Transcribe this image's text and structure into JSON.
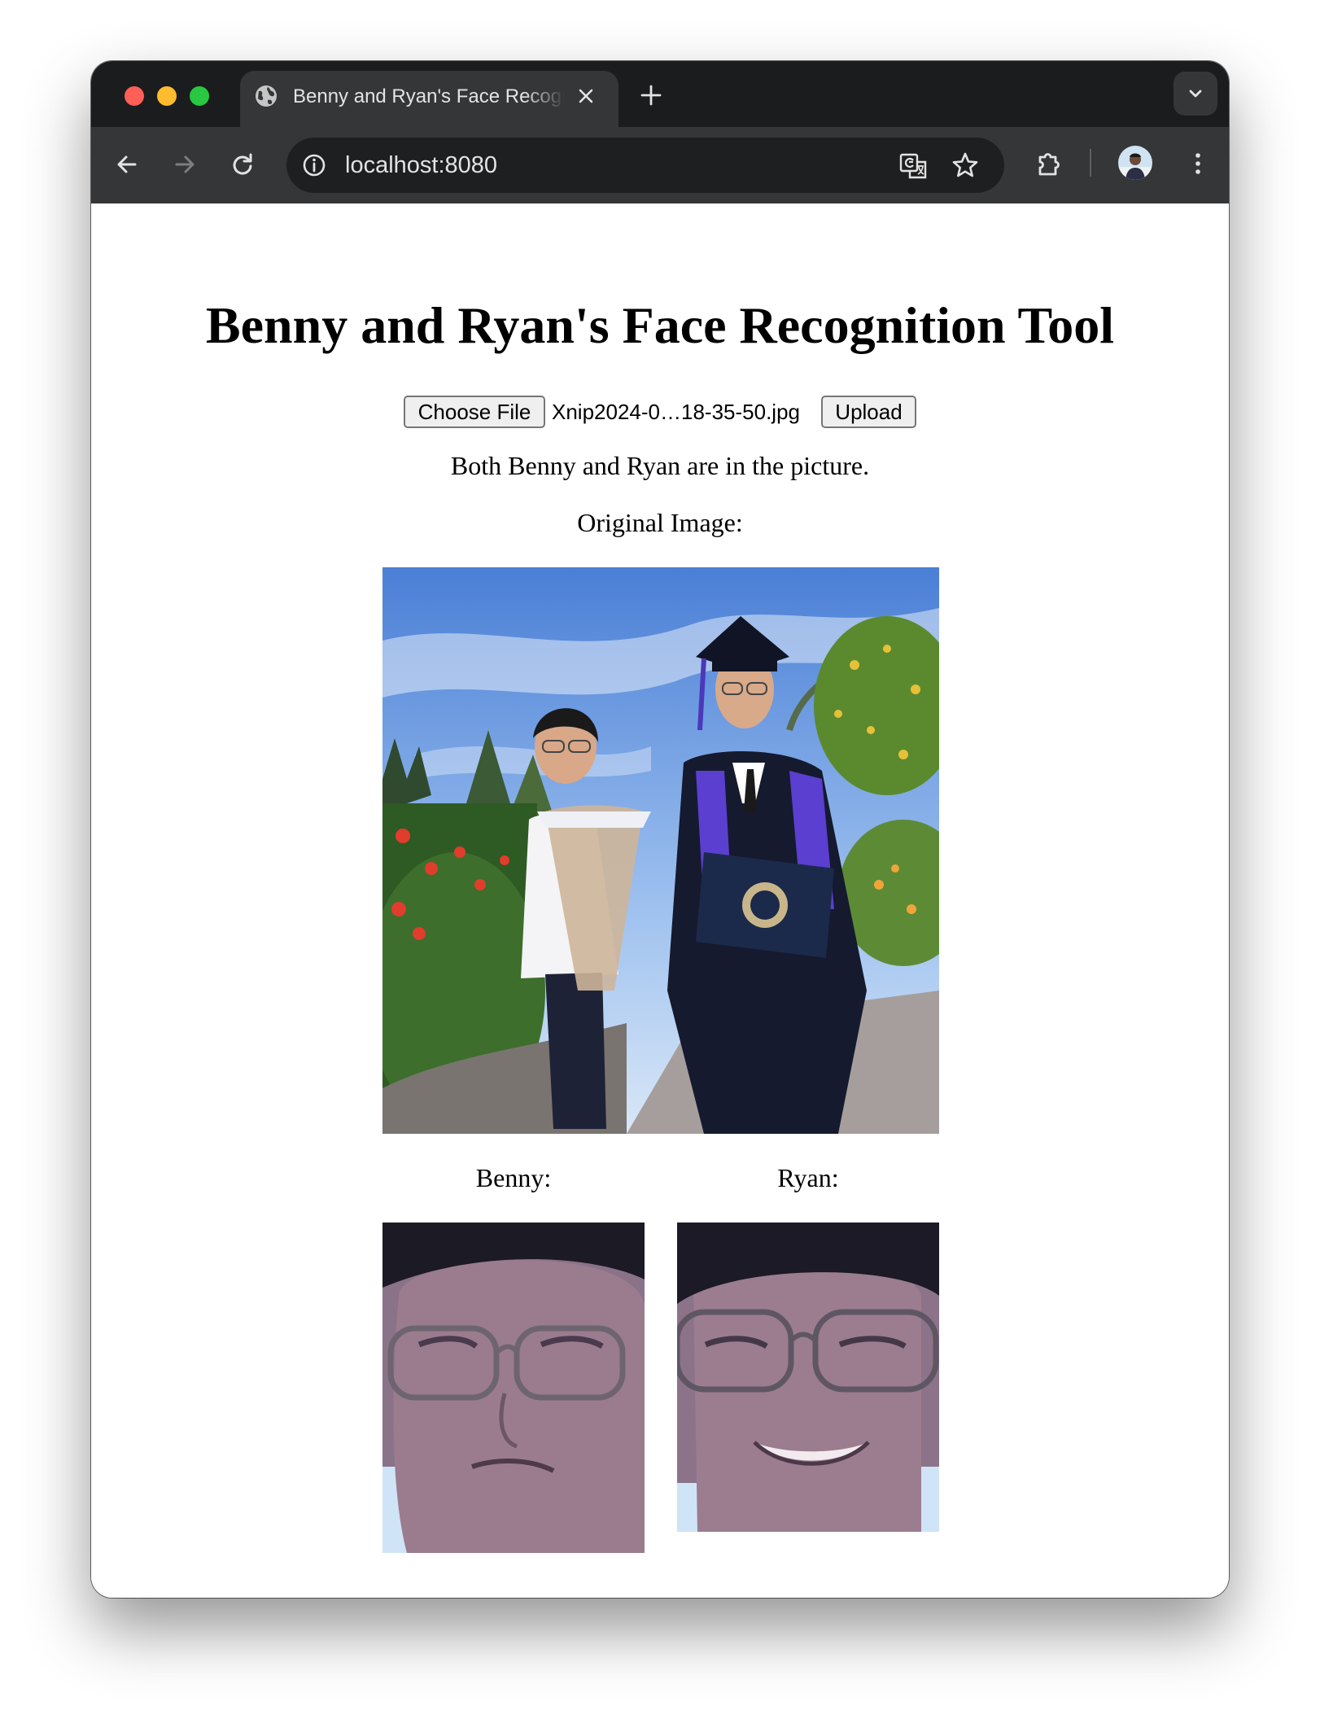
{
  "browser": {
    "tab_title": "Benny and Ryan's Face Recognition Tool",
    "url": "localhost:8080"
  },
  "page": {
    "title": "Benny and Ryan's Face Recognition Tool",
    "choose_file_label": "Choose File",
    "file_name": "Xnip2024-0…18-35-50.jpg",
    "upload_label": "Upload",
    "result_text": "Both Benny and Ryan are in the picture.",
    "original_image_label": "Original Image:",
    "faces": [
      {
        "label": "Benny:"
      },
      {
        "label": "Ryan:"
      }
    ]
  },
  "icons": {
    "tab_favicon": "globe-icon",
    "tab_close": "close-icon",
    "new_tab": "plus-icon",
    "tab_search": "chevron-down-icon",
    "back": "arrow-left-icon",
    "forward": "arrow-right-icon",
    "reload": "reload-icon",
    "site_info": "info-icon",
    "translate": "translate-icon",
    "bookmark": "star-icon",
    "extensions": "puzzle-icon",
    "profile": "avatar",
    "menu": "kebab-menu-icon"
  },
  "colors": {
    "tab_strip": "#1b1c1d",
    "toolbar": "#353637",
    "omnibox": "#1e1f20",
    "page_background": "#ffffff"
  }
}
